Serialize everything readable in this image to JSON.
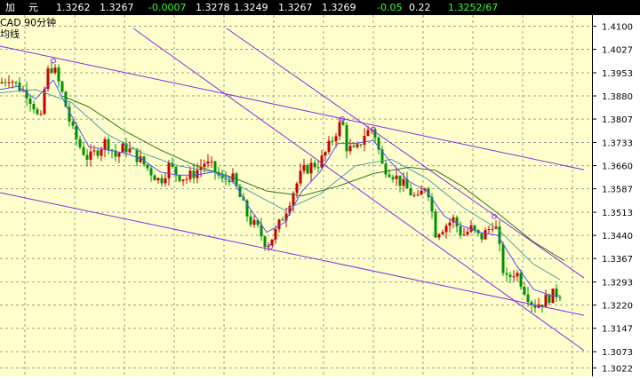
{
  "header": {
    "symbol_part1": "加",
    "symbol_part2": "元",
    "fields": [
      {
        "text": "1.3262",
        "color": "#ffffff"
      },
      {
        "text": "1.3267",
        "color": "#ffffff"
      },
      {
        "text": "-0.0007",
        "color": "#33ff33"
      },
      {
        "text": "1.3278",
        "color": "#ffffff"
      },
      {
        "text": "1.3249",
        "color": "#ffffff"
      },
      {
        "text": "1.3267",
        "color": "#ffffff"
      },
      {
        "text": "1.3269",
        "color": "#ffffff"
      },
      {
        "text": "-0.05",
        "color": "#33ff33"
      },
      {
        "text": "0.22",
        "color": "#ffffff"
      },
      {
        "text": "1.3252/67",
        "color": "#33ff33"
      }
    ]
  },
  "chart_label": {
    "line1": "CAD  90分钟",
    "line2": "均线"
  },
  "colors": {
    "background": "#ffffcc",
    "grid": "#9aa690",
    "up_candle": "#c80000",
    "down_candle": "#009000",
    "ma_short": "#5050ff",
    "ma_mid": "#50a0a0",
    "ma_long": "#307a20",
    "trendline": "#8a2be2"
  },
  "chart_data": {
    "type": "candlestick",
    "ylim": [
      1.2995,
      1.4135
    ],
    "y_ticks": [
      "1.4100",
      "1.4027",
      "1.3953",
      "1.3880",
      "1.3807",
      "1.3733",
      "1.3660",
      "1.3587",
      "1.3513",
      "1.3440",
      "1.3367",
      "1.3293",
      "1.3220",
      "1.3147",
      "1.3073",
      "1.3022"
    ],
    "x_range": [
      0,
      660
    ],
    "close_path": [
      [
        0,
        1.392
      ],
      [
        10,
        1.394
      ],
      [
        20,
        1.391
      ],
      [
        30,
        1.389
      ],
      [
        40,
        1.384
      ],
      [
        45,
        1.378
      ],
      [
        50,
        1.39
      ],
      [
        55,
        1.397
      ],
      [
        60,
        1.397
      ],
      [
        65,
        1.393
      ],
      [
        72,
        1.387
      ],
      [
        80,
        1.378
      ],
      [
        90,
        1.372
      ],
      [
        100,
        1.368
      ],
      [
        110,
        1.371
      ],
      [
        120,
        1.374
      ],
      [
        130,
        1.369
      ],
      [
        140,
        1.372
      ],
      [
        150,
        1.37
      ],
      [
        160,
        1.367
      ],
      [
        170,
        1.364
      ],
      [
        180,
        1.361
      ],
      [
        190,
        1.366
      ],
      [
        200,
        1.363
      ],
      [
        210,
        1.362
      ],
      [
        220,
        1.364
      ],
      [
        230,
        1.367
      ],
      [
        240,
        1.365
      ],
      [
        250,
        1.361
      ],
      [
        260,
        1.363
      ],
      [
        270,
        1.356
      ],
      [
        280,
        1.349
      ],
      [
        290,
        1.346
      ],
      [
        300,
        1.341
      ],
      [
        310,
        1.345
      ],
      [
        320,
        1.351
      ],
      [
        330,
        1.358
      ],
      [
        340,
        1.364
      ],
      [
        350,
        1.366
      ],
      [
        360,
        1.367
      ],
      [
        370,
        1.372
      ],
      [
        380,
        1.378
      ],
      [
        385,
        1.38
      ],
      [
        390,
        1.372
      ],
      [
        400,
        1.37
      ],
      [
        410,
        1.376
      ],
      [
        420,
        1.378
      ],
      [
        430,
        1.366
      ],
      [
        440,
        1.364
      ],
      [
        450,
        1.361
      ],
      [
        460,
        1.358
      ],
      [
        470,
        1.355
      ],
      [
        480,
        1.361
      ],
      [
        490,
        1.345
      ],
      [
        500,
        1.347
      ],
      [
        510,
        1.349
      ],
      [
        520,
        1.344
      ],
      [
        530,
        1.346
      ],
      [
        540,
        1.343
      ],
      [
        550,
        1.346
      ],
      [
        556,
        1.349
      ],
      [
        560,
        1.343
      ],
      [
        565,
        1.334
      ],
      [
        570,
        1.33
      ],
      [
        580,
        1.333
      ],
      [
        590,
        1.327
      ],
      [
        600,
        1.322
      ],
      [
        610,
        1.323
      ],
      [
        620,
        1.325
      ],
      [
        630,
        1.326
      ]
    ],
    "series": [
      {
        "kind": "ma_short",
        "points": [
          [
            0,
            1.39
          ],
          [
            20,
            1.391
          ],
          [
            40,
            1.387
          ],
          [
            60,
            1.393
          ],
          [
            80,
            1.382
          ],
          [
            100,
            1.372
          ],
          [
            120,
            1.371
          ],
          [
            140,
            1.37
          ],
          [
            160,
            1.368
          ],
          [
            180,
            1.364
          ],
          [
            200,
            1.363
          ],
          [
            220,
            1.363
          ],
          [
            240,
            1.364
          ],
          [
            260,
            1.362
          ],
          [
            280,
            1.353
          ],
          [
            300,
            1.345
          ],
          [
            320,
            1.348
          ],
          [
            340,
            1.358
          ],
          [
            360,
            1.364
          ],
          [
            380,
            1.373
          ],
          [
            400,
            1.373
          ],
          [
            420,
            1.374
          ],
          [
            440,
            1.367
          ],
          [
            460,
            1.361
          ],
          [
            480,
            1.358
          ],
          [
            500,
            1.35
          ],
          [
            520,
            1.347
          ],
          [
            540,
            1.345
          ],
          [
            560,
            1.344
          ],
          [
            580,
            1.335
          ],
          [
            600,
            1.327
          ],
          [
            620,
            1.325
          ],
          [
            630,
            1.325
          ]
        ]
      },
      {
        "kind": "ma_mid",
        "points": [
          [
            0,
            1.389
          ],
          [
            40,
            1.39
          ],
          [
            80,
            1.386
          ],
          [
            120,
            1.376
          ],
          [
            160,
            1.37
          ],
          [
            200,
            1.366
          ],
          [
            240,
            1.364
          ],
          [
            280,
            1.358
          ],
          [
            320,
            1.352
          ],
          [
            360,
            1.357
          ],
          [
            400,
            1.366
          ],
          [
            440,
            1.368
          ],
          [
            480,
            1.362
          ],
          [
            520,
            1.353
          ],
          [
            560,
            1.346
          ],
          [
            600,
            1.335
          ],
          [
            630,
            1.33
          ]
        ]
      },
      {
        "kind": "ma_long",
        "points": [
          [
            70,
            1.388
          ],
          [
            100,
            1.3845
          ],
          [
            140,
            1.377
          ],
          [
            180,
            1.371
          ],
          [
            220,
            1.366
          ],
          [
            260,
            1.3625
          ],
          [
            300,
            1.358
          ],
          [
            340,
            1.3565
          ],
          [
            380,
            1.3595
          ],
          [
            420,
            1.3635
          ],
          [
            460,
            1.3655
          ],
          [
            490,
            1.3645
          ],
          [
            520,
            1.3595
          ],
          [
            560,
            1.351
          ],
          [
            600,
            1.342
          ],
          [
            635,
            1.336
          ]
        ]
      }
    ],
    "trendlines": [
      {
        "from": [
          0,
          1.4037
        ],
        "to": [
          657,
          1.3647
        ]
      },
      {
        "from": [
          0,
          1.3575
        ],
        "to": [
          657,
          1.3188
        ]
      },
      {
        "from": [
          150,
          1.4093
        ],
        "to": [
          657,
          1.3077
        ]
      },
      {
        "from": [
          255,
          1.4093
        ],
        "to": [
          657,
          1.3306
        ]
      }
    ],
    "markers": [
      [
        60,
        1.3991
      ],
      [
        385,
        1.3807
      ],
      [
        420,
        1.3775
      ],
      [
        556,
        1.35
      ],
      [
        304,
        1.3404
      ]
    ]
  }
}
